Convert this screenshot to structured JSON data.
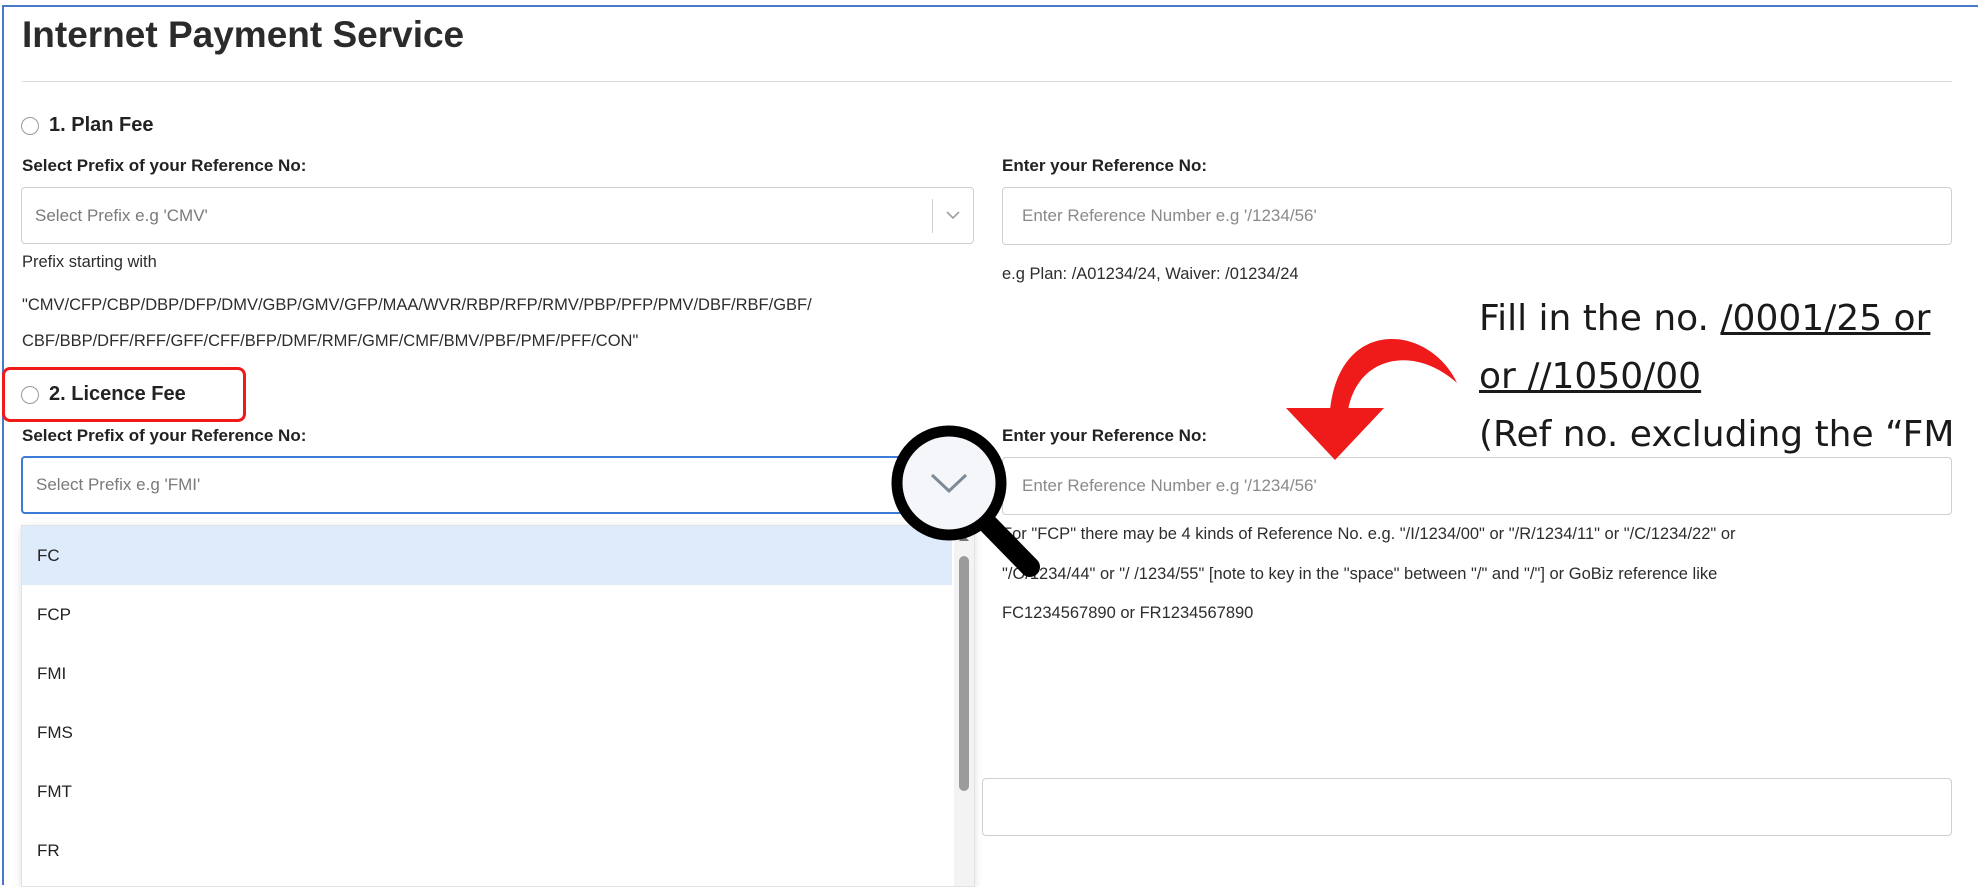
{
  "page": {
    "title": "Internet Payment Service"
  },
  "colors": {
    "accent_blue": "#3d7bd9",
    "highlight_red": "#ef1a1a",
    "option_hover": "#deebfb"
  },
  "plan_fee": {
    "radio_label": "1.  Plan Fee",
    "prefix_label": "Select Prefix of your Reference No:",
    "prefix_placeholder": "Select Prefix e.g 'CMV'",
    "ref_label": "Enter your Reference No:",
    "ref_placeholder": "Enter Reference Number e.g '/1234/56'",
    "ref_hint": "e.g Plan: /A01234/24, Waiver: /01234/24",
    "prefix_note_1": "Prefix starting with",
    "prefix_note_2": "\"CMV/CFP/CBP/DBP/DFP/DMV/GBP/GMV/GFP/MAA/WVR/RBP/RFP/RMV/PBP/PFP/PMV/DBF/RBF/GBF/",
    "prefix_note_3": "CBF/BBP/DFF/RFF/GFF/CFF/BFP/DMF/RMF/GMF/CMF/BMV/PBF/PMF/PFF/CON\""
  },
  "licence_fee": {
    "radio_label": "2.  Licence Fee",
    "prefix_label": "Select Prefix of your Reference No:",
    "prefix_placeholder": "Select Prefix e.g 'FMI'",
    "ref_label": "Enter your Reference No:",
    "ref_placeholder": "Enter Reference Number e.g '/1234/56'",
    "note_1": "For \"FCP\" there may be 4 kinds of Reference No. e.g. \"/I/1234/00\" or \"/R/1234/11\" or \"/C/1234/22\" or",
    "note_2": "\"/O/1234/44\" or \"/ /1234/55\" [note to key in the \"space\" between \"/\" and \"/\"] or GoBiz reference like",
    "note_3": "FC1234567890 or FR1234567890"
  },
  "dropdown": {
    "options": [
      "FC",
      "FCP",
      "FMI",
      "FMS",
      "FMT",
      "FR"
    ]
  },
  "annotation": {
    "line1_a": "Fill in the no. ",
    "line1_b": "/0001/25 or",
    "line2": "or //1050/00",
    "line3": "(Ref no. excluding the “FM"
  },
  "icons": {
    "dropdown_chevron": "chevron-down-icon",
    "magnifier": "magnifier-icon",
    "curved_arrow": "curved-arrow-icon"
  }
}
